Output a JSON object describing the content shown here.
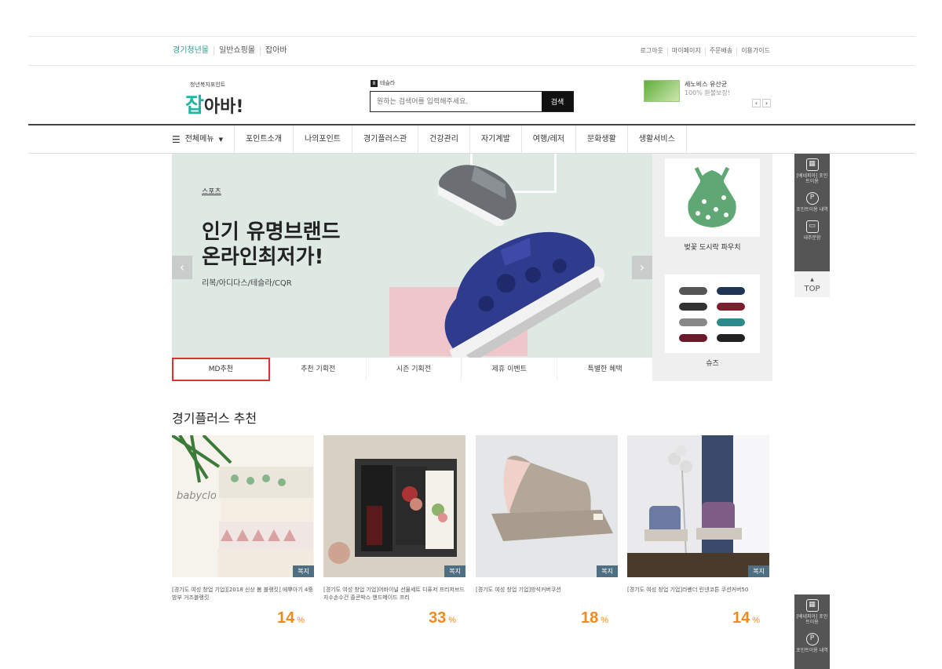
{
  "util": {
    "left_links": [
      "경기청년몰",
      "일반쇼핑몰",
      "잡아바"
    ],
    "right_links": [
      "로그아웃",
      "마이페이지",
      "주문배송",
      "이용가이드"
    ]
  },
  "header": {
    "logo_sub": "청년복지포인트",
    "logo_accent": "잡",
    "logo_text": "아바!",
    "search_brand": "테슬라",
    "search_placeholder": "원하는 검색어를 입력해주세요.",
    "search_button": "검색",
    "promo_title": "세노비스 유산균",
    "promo_sub": "100% 환불보장!"
  },
  "nav": {
    "all_menu": "전체메뉴",
    "items": [
      "포인트소개",
      "나의포인트",
      "경기플러스관",
      "건강관리",
      "자기계발",
      "여행/레저",
      "문화생활",
      "생활서비스"
    ]
  },
  "hero": {
    "category": "스포츠",
    "headline_1": "인기 유명브랜드",
    "headline_2": "온라인최저가!",
    "brands": "리복/아디다스/테슬라/CQR",
    "tabs": [
      "MD추천",
      "추천 기획전",
      "시즌 기획전",
      "제휴 이벤트",
      "특별한 혜택"
    ]
  },
  "side": {
    "item1": "벚꽃 도시락 파우치",
    "item2": "슈즈"
  },
  "quick": {
    "items": [
      "[베네피아] 포인트이용",
      "포인트이용 내역",
      "내주문함"
    ],
    "top": "TOP"
  },
  "recommend": {
    "title": "경기플러스 추천",
    "products": [
      {
        "name": "[경기도 여성 창업 기업][2018 신상 봄 블랭킷] 에뿌아기 4중 밤부 거즈블랭킷",
        "discount": "14",
        "tag": "복지",
        "brand": "babyclo"
      },
      {
        "name": "[경기도 여성 창업 기업]어바이널 선물세트 디퓨저 프리저브드 자수손수건 졸콘박스 핸드메이드 프리",
        "discount": "33",
        "tag": "복지"
      },
      {
        "name": "[경기도 여성 창업 기업]방석커버쿠션",
        "discount": "18",
        "tag": "복지"
      },
      {
        "name": "[경기도 여성 창업 기업]라벤더 린넨코튼 쿠션커버50",
        "discount": "14",
        "tag": "복지"
      }
    ],
    "pct": "%"
  }
}
